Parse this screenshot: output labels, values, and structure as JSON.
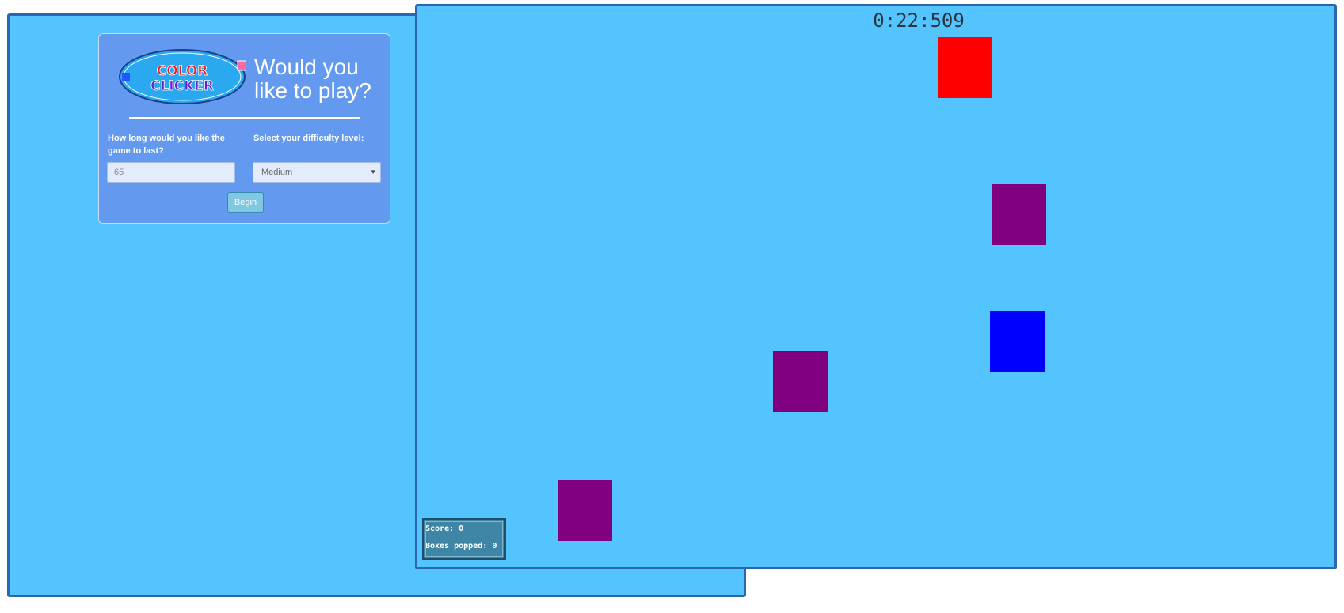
{
  "menu": {
    "logo_line1": "COLOR",
    "logo_line2": "CLICKER",
    "headline": "Would you like to play?",
    "duration_label": "How long would you like the game to last?",
    "duration_value": "65",
    "difficulty_label": "Select your difficulty level:",
    "difficulty_selected": "Medium",
    "begin_label": "Begin"
  },
  "game": {
    "timer": "0:22:509",
    "score_label": "Score:",
    "score": "0",
    "boxes_label": "Boxes popped:",
    "boxes_popped": "0",
    "boxes": [
      {
        "color": "#ff0000"
      },
      {
        "color": "#800080"
      },
      {
        "color": "#0000ff"
      },
      {
        "color": "#800080"
      },
      {
        "color": "#800080"
      }
    ]
  },
  "colors": {
    "background": "#53c4fd",
    "window_border": "#2a67ae",
    "panel": "#6399ef",
    "button": "#7fc7e3",
    "scoreboard": "#3f86a6"
  }
}
